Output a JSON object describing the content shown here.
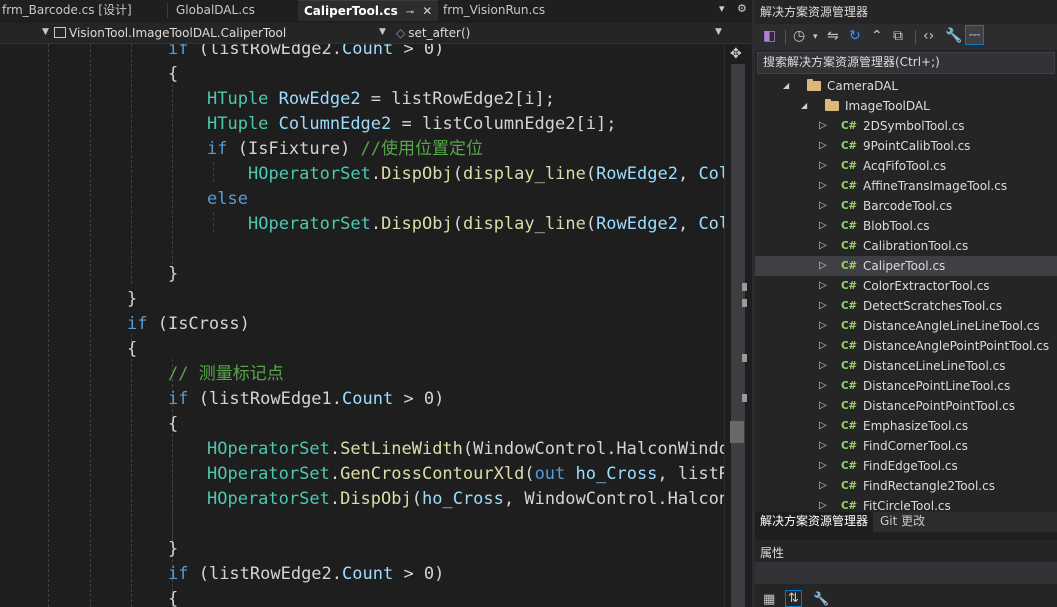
{
  "tabs": [
    {
      "label": "frm_Barcode.cs [设计]",
      "active": false
    },
    {
      "label": "GlobalDAL.cs",
      "active": false
    },
    {
      "label": "CaliperTool.cs",
      "active": true
    },
    {
      "label": "frm_VisionRun.cs",
      "active": false
    }
  ],
  "tab_icons": {
    "pin": "⊸",
    "close": "✕",
    "overflow": "▾",
    "settings": "⚙"
  },
  "navbar": {
    "class_path": "VisionTool.ImageToolDAL.CaliperTool",
    "member": "set_after()"
  },
  "code": [
    [
      {
        "c": "kw",
        "t": "if"
      },
      {
        "c": "pl",
        "t": " (listRowEdge2."
      },
      {
        "c": "id",
        "t": "Count"
      },
      {
        "c": "pl",
        "t": " > 0)"
      }
    ],
    [
      {
        "c": "pl",
        "t": "{"
      }
    ],
    [
      {
        "c": "ty",
        "t": "HTuple"
      },
      {
        "c": "pl",
        "t": " "
      },
      {
        "c": "id",
        "t": "RowEdge2"
      },
      {
        "c": "pl",
        "t": " = listRowEdge2[i];"
      }
    ],
    [
      {
        "c": "ty",
        "t": "HTuple"
      },
      {
        "c": "pl",
        "t": " "
      },
      {
        "c": "id",
        "t": "ColumnEdge2"
      },
      {
        "c": "pl",
        "t": " = listColumnEdge2[i];"
      }
    ],
    [
      {
        "c": "kw",
        "t": "if"
      },
      {
        "c": "pl",
        "t": " (IsFixture) "
      },
      {
        "c": "cm",
        "t": "//使用位置定位"
      }
    ],
    [
      {
        "c": "ty",
        "t": "HOperatorSet"
      },
      {
        "c": "pl",
        "t": "."
      },
      {
        "c": "fn",
        "t": "DispObj"
      },
      {
        "c": "pl",
        "t": "("
      },
      {
        "c": "fn",
        "t": "display_line"
      },
      {
        "c": "pl",
        "t": "("
      },
      {
        "c": "id",
        "t": "RowEdge2"
      },
      {
        "c": "pl",
        "t": ", "
      },
      {
        "c": "id",
        "t": "Col"
      }
    ],
    [
      {
        "c": "kw",
        "t": "else"
      }
    ],
    [
      {
        "c": "ty",
        "t": "HOperatorSet"
      },
      {
        "c": "pl",
        "t": "."
      },
      {
        "c": "fn",
        "t": "DispObj"
      },
      {
        "c": "pl",
        "t": "("
      },
      {
        "c": "fn",
        "t": "display_line"
      },
      {
        "c": "pl",
        "t": "("
      },
      {
        "c": "id",
        "t": "RowEdge2"
      },
      {
        "c": "pl",
        "t": ", "
      },
      {
        "c": "id",
        "t": "Col"
      }
    ],
    [],
    [
      {
        "c": "pl",
        "t": "}"
      }
    ],
    [
      {
        "c": "pl",
        "t": "}"
      }
    ],
    [
      {
        "c": "kw",
        "t": "if"
      },
      {
        "c": "pl",
        "t": " (IsCross)"
      }
    ],
    [
      {
        "c": "pl",
        "t": "{"
      }
    ],
    [
      {
        "c": "cm",
        "t": "// 测量标记点"
      }
    ],
    [
      {
        "c": "kw",
        "t": "if"
      },
      {
        "c": "pl",
        "t": " (listRowEdge1."
      },
      {
        "c": "id",
        "t": "Count"
      },
      {
        "c": "pl",
        "t": " > 0)"
      }
    ],
    [
      {
        "c": "pl",
        "t": "{"
      }
    ],
    [
      {
        "c": "ty",
        "t": "HOperatorSet"
      },
      {
        "c": "pl",
        "t": "."
      },
      {
        "c": "fn",
        "t": "SetLineWidth"
      },
      {
        "c": "pl",
        "t": "(WindowControl.HalconWindo"
      }
    ],
    [
      {
        "c": "ty",
        "t": "HOperatorSet"
      },
      {
        "c": "pl",
        "t": "."
      },
      {
        "c": "fn",
        "t": "GenCrossContourXld"
      },
      {
        "c": "pl",
        "t": "("
      },
      {
        "c": "kw",
        "t": "out"
      },
      {
        "c": "pl",
        "t": " "
      },
      {
        "c": "id",
        "t": "ho_Cross"
      },
      {
        "c": "pl",
        "t": ", listR"
      }
    ],
    [
      {
        "c": "ty",
        "t": "HOperatorSet"
      },
      {
        "c": "pl",
        "t": "."
      },
      {
        "c": "fn",
        "t": "DispObj"
      },
      {
        "c": "pl",
        "t": "("
      },
      {
        "c": "id",
        "t": "ho_Cross"
      },
      {
        "c": "pl",
        "t": ", WindowControl.Halcon"
      }
    ],
    [],
    [
      {
        "c": "pl",
        "t": "}"
      }
    ],
    [
      {
        "c": "kw",
        "t": "if"
      },
      {
        "c": "pl",
        "t": " (listRowEdge2."
      },
      {
        "c": "id",
        "t": "Count"
      },
      {
        "c": "pl",
        "t": " > 0)"
      }
    ],
    [
      {
        "c": "pl",
        "t": "{"
      }
    ]
  ],
  "solution_explorer": {
    "title": "解决方案资源管理器",
    "search_placeholder": "搜索解决方案资源管理器(Ctrl+;)",
    "tree": [
      {
        "label": "CameraDAL",
        "type": "folder",
        "level": 0,
        "expanded": true
      },
      {
        "label": "ImageToolDAL",
        "type": "folder",
        "level": 1,
        "expanded": true
      },
      {
        "label": "2DSymbolTool.cs",
        "type": "cs",
        "level": 2
      },
      {
        "label": "9PointCalibTool.cs",
        "type": "cs",
        "level": 2
      },
      {
        "label": "AcqFifoTool.cs",
        "type": "cs",
        "level": 2
      },
      {
        "label": "AffineTransImageTool.cs",
        "type": "cs",
        "level": 2
      },
      {
        "label": "BarcodeTool.cs",
        "type": "cs",
        "level": 2
      },
      {
        "label": "BlobTool.cs",
        "type": "cs",
        "level": 2
      },
      {
        "label": "CalibrationTool.cs",
        "type": "cs",
        "level": 2
      },
      {
        "label": "CaliperTool.cs",
        "type": "cs",
        "level": 2,
        "selected": true
      },
      {
        "label": "ColorExtractorTool.cs",
        "type": "cs",
        "level": 2
      },
      {
        "label": "DetectScratchesTool.cs",
        "type": "cs",
        "level": 2
      },
      {
        "label": "DistanceAngleLineLineTool.cs",
        "type": "cs",
        "level": 2
      },
      {
        "label": "DistanceAnglePointPointTool.cs",
        "type": "cs",
        "level": 2
      },
      {
        "label": "DistanceLineLineTool.cs",
        "type": "cs",
        "level": 2
      },
      {
        "label": "DistancePointLineTool.cs",
        "type": "cs",
        "level": 2
      },
      {
        "label": "DistancePointPointTool.cs",
        "type": "cs",
        "level": 2
      },
      {
        "label": "EmphasizeTool.cs",
        "type": "cs",
        "level": 2
      },
      {
        "label": "FindCornerTool.cs",
        "type": "cs",
        "level": 2
      },
      {
        "label": "FindEdgeTool.cs",
        "type": "cs",
        "level": 2
      },
      {
        "label": "FindRectangle2Tool.cs",
        "type": "cs",
        "level": 2
      },
      {
        "label": "FitCircleTool.cs",
        "type": "cs",
        "level": 2
      }
    ],
    "cs_badge": "C#",
    "bottom_tabs": [
      "解决方案资源管理器",
      "Git 更改"
    ]
  },
  "properties": {
    "title": "属性"
  },
  "colors": {
    "accent": "#007acc",
    "cs_icon": "#9bd26a",
    "folder": "#dcb67a",
    "selected_row": "#3f3f46"
  }
}
